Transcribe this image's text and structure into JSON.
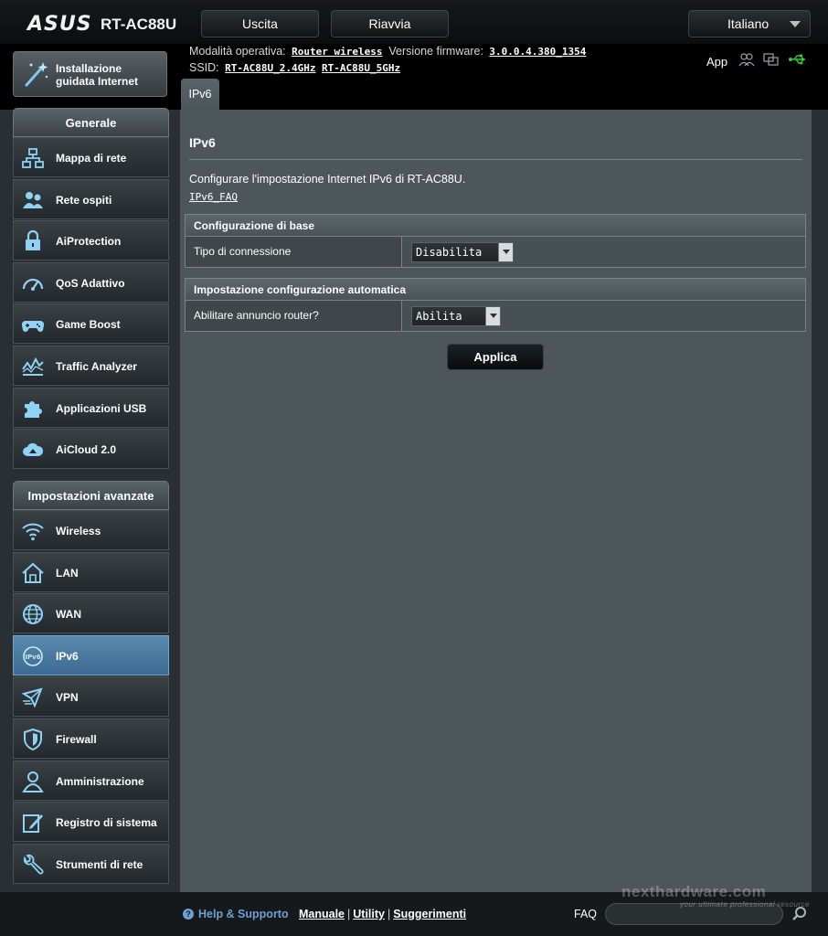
{
  "header": {
    "brand": "ASUS",
    "model": "RT-AC88U",
    "logout_label": "Uscita",
    "reboot_label": "Riavvia",
    "language": "Italiano",
    "app_label": "App"
  },
  "status": {
    "mode_label": "Modalità operativa:",
    "mode_value": "Router wireless",
    "firmware_label": "Versione firmware:",
    "firmware_value": "3.0.0.4.380_1354",
    "ssid_label": "SSID:",
    "ssid_24": "RT-AC88U_2.4GHz",
    "ssid_5": "RT-AC88U_5GHz"
  },
  "wizard": {
    "line1": "Installazione",
    "line2": "guidata Internet"
  },
  "sidebar": {
    "general_title": "Generale",
    "general_items": [
      {
        "label": "Mappa di rete",
        "icon": "network-map-icon"
      },
      {
        "label": "Rete ospiti",
        "icon": "guest-network-icon"
      },
      {
        "label": "AiProtection",
        "icon": "lock-icon"
      },
      {
        "label": "QoS Adattivo",
        "icon": "speedometer-icon"
      },
      {
        "label": "Game Boost",
        "icon": "gamepad-icon"
      },
      {
        "label": "Traffic Analyzer",
        "icon": "traffic-graph-icon"
      },
      {
        "label": "Applicazioni USB",
        "icon": "puzzle-icon"
      },
      {
        "label": "AiCloud 2.0",
        "icon": "cloud-icon"
      }
    ],
    "advanced_title": "Impostazioni avanzate",
    "advanced_items": [
      {
        "label": "Wireless",
        "icon": "wifi-icon"
      },
      {
        "label": "LAN",
        "icon": "house-icon"
      },
      {
        "label": "WAN",
        "icon": "globe-icon"
      },
      {
        "label": "IPv6",
        "icon": "ipv6-icon",
        "active": true
      },
      {
        "label": "VPN",
        "icon": "vpn-icon"
      },
      {
        "label": "Firewall",
        "icon": "shield-icon"
      },
      {
        "label": "Amministrazione",
        "icon": "user-icon"
      },
      {
        "label": "Registro di sistema",
        "icon": "log-edit-icon"
      },
      {
        "label": "Strumenti di rete",
        "icon": "tools-icon"
      }
    ]
  },
  "content": {
    "tab_label": "IPv6",
    "title": "IPv6",
    "description": "Configurare l'impostazione Internet IPv6 di RT-AC88U.",
    "faq_link": "IPv6_FAQ",
    "basic_section": {
      "title": "Configurazione di base",
      "connection_type_label": "Tipo di connessione",
      "connection_type_value": "Disabilita"
    },
    "auto_section": {
      "title": "Impostazione configurazione automatica",
      "router_adv_label": "Abilitare annuncio router?",
      "router_adv_value": "Abilita"
    },
    "apply_label": "Applica"
  },
  "footer": {
    "help": "Help & Supporto",
    "manual": "Manuale",
    "utility": "Utility",
    "feedback": "Suggerimenti",
    "faq": "FAQ"
  },
  "watermark": {
    "main": "nexthardware.com",
    "tagline": "your ultimate professional resource"
  },
  "colors": {
    "accent": "#5a8ab0",
    "link_blue": "#6f9fd0",
    "usb_green": "#33cc33"
  }
}
